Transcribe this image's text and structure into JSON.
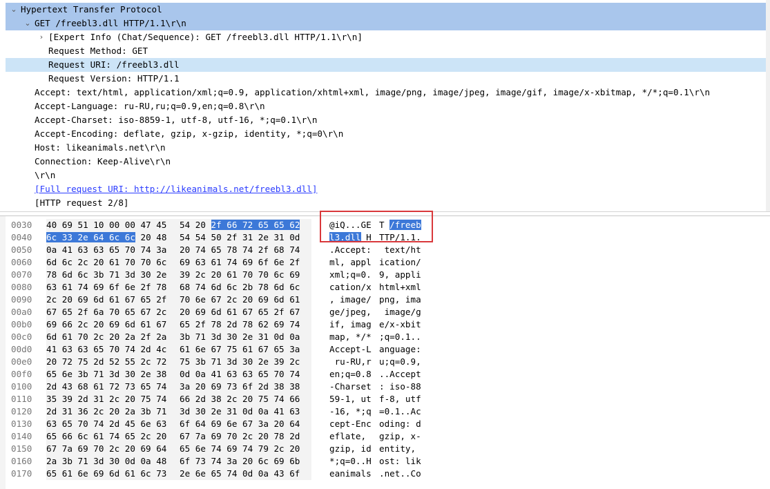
{
  "detail": {
    "rows": [
      {
        "text": "Hypertext Transfer Protocol",
        "arrow": "⌄",
        "level": 0,
        "highlight": "strong"
      },
      {
        "text": "GET /freebl3.dll HTTP/1.1\\r\\n",
        "arrow": "⌄",
        "level": 1,
        "highlight": "strong"
      },
      {
        "text": "[Expert Info (Chat/Sequence): GET /freebl3.dll HTTP/1.1\\r\\n]",
        "arrow": "›",
        "level": 2,
        "highlight": "none"
      },
      {
        "text": "Request Method: GET",
        "arrow": "",
        "level": 2,
        "highlight": "none"
      },
      {
        "text": "Request URI: /freebl3.dll",
        "arrow": "",
        "level": 2,
        "highlight": "light"
      },
      {
        "text": "Request Version: HTTP/1.1",
        "arrow": "",
        "level": 2,
        "highlight": "none"
      },
      {
        "text": "Accept: text/html, application/xml;q=0.9, application/xhtml+xml, image/png, image/jpeg, image/gif, image/x-xbitmap, */*;q=0.1\\r\\n",
        "arrow": "",
        "level": 1,
        "highlight": "none"
      },
      {
        "text": "Accept-Language: ru-RU,ru;q=0.9,en;q=0.8\\r\\n",
        "arrow": "",
        "level": 1,
        "highlight": "none"
      },
      {
        "text": "Accept-Charset: iso-8859-1, utf-8, utf-16, *;q=0.1\\r\\n",
        "arrow": "",
        "level": 1,
        "highlight": "none"
      },
      {
        "text": "Accept-Encoding: deflate, gzip, x-gzip, identity, *;q=0\\r\\n",
        "arrow": "",
        "level": 1,
        "highlight": "none"
      },
      {
        "text": "Host: likeanimals.net\\r\\n",
        "arrow": "",
        "level": 1,
        "highlight": "none"
      },
      {
        "text": "Connection: Keep-Alive\\r\\n",
        "arrow": "",
        "level": 1,
        "highlight": "none"
      },
      {
        "text": "\\r\\n",
        "arrow": "",
        "level": 1,
        "highlight": "none"
      },
      {
        "text": "[Full request URI: http://likeanimals.net/freebl3.dll]",
        "arrow": "",
        "level": 1,
        "highlight": "none",
        "link": true
      },
      {
        "text": "[HTTP request 2/8]",
        "arrow": "",
        "level": 1,
        "highlight": "none"
      }
    ]
  },
  "bytes": {
    "rows": [
      {
        "offset": "0030",
        "hex_lo": "40 69 51 10 00 00 47 45",
        "hex_hi": "54 20 2f 66 72 65 65 62",
        "ascii_lo": "@iQ...GE",
        "ascii_hi": "T /freeb"
      },
      {
        "offset": "0040",
        "hex_lo": "6c 33 2e 64 6c 6c 20 48",
        "hex_hi": "54 54 50 2f 31 2e 31 0d",
        "ascii_lo": "l3.dll H",
        "ascii_hi": "TTP/1.1."
      },
      {
        "offset": "0050",
        "hex_lo": "0a 41 63 63 65 70 74 3a",
        "hex_hi": "20 74 65 78 74 2f 68 74",
        "ascii_lo": ".Accept:",
        "ascii_hi": " text/ht"
      },
      {
        "offset": "0060",
        "hex_lo": "6d 6c 2c 20 61 70 70 6c",
        "hex_hi": "69 63 61 74 69 6f 6e 2f",
        "ascii_lo": "ml, appl",
        "ascii_hi": "ication/"
      },
      {
        "offset": "0070",
        "hex_lo": "78 6d 6c 3b 71 3d 30 2e",
        "hex_hi": "39 2c 20 61 70 70 6c 69",
        "ascii_lo": "xml;q=0.",
        "ascii_hi": "9, appli"
      },
      {
        "offset": "0080",
        "hex_lo": "63 61 74 69 6f 6e 2f 78",
        "hex_hi": "68 74 6d 6c 2b 78 6d 6c",
        "ascii_lo": "cation/x",
        "ascii_hi": "html+xml"
      },
      {
        "offset": "0090",
        "hex_lo": "2c 20 69 6d 61 67 65 2f",
        "hex_hi": "70 6e 67 2c 20 69 6d 61",
        "ascii_lo": ", image/",
        "ascii_hi": "png, ima"
      },
      {
        "offset": "00a0",
        "hex_lo": "67 65 2f 6a 70 65 67 2c",
        "hex_hi": "20 69 6d 61 67 65 2f 67",
        "ascii_lo": "ge/jpeg,",
        "ascii_hi": " image/g"
      },
      {
        "offset": "00b0",
        "hex_lo": "69 66 2c 20 69 6d 61 67",
        "hex_hi": "65 2f 78 2d 78 62 69 74",
        "ascii_lo": "if, imag",
        "ascii_hi": "e/x-xbit"
      },
      {
        "offset": "00c0",
        "hex_lo": "6d 61 70 2c 20 2a 2f 2a",
        "hex_hi": "3b 71 3d 30 2e 31 0d 0a",
        "ascii_lo": "map, */*",
        "ascii_hi": ";q=0.1.."
      },
      {
        "offset": "00d0",
        "hex_lo": "41 63 63 65 70 74 2d 4c",
        "hex_hi": "61 6e 67 75 61 67 65 3a",
        "ascii_lo": "Accept-L",
        "ascii_hi": "anguage:"
      },
      {
        "offset": "00e0",
        "hex_lo": "20 72 75 2d 52 55 2c 72",
        "hex_hi": "75 3b 71 3d 30 2e 39 2c",
        "ascii_lo": " ru-RU,r",
        "ascii_hi": "u;q=0.9,"
      },
      {
        "offset": "00f0",
        "hex_lo": "65 6e 3b 71 3d 30 2e 38",
        "hex_hi": "0d 0a 41 63 63 65 70 74",
        "ascii_lo": "en;q=0.8",
        "ascii_hi": "..Accept"
      },
      {
        "offset": "0100",
        "hex_lo": "2d 43 68 61 72 73 65 74",
        "hex_hi": "3a 20 69 73 6f 2d 38 38",
        "ascii_lo": "-Charset",
        "ascii_hi": ": iso-88"
      },
      {
        "offset": "0110",
        "hex_lo": "35 39 2d 31 2c 20 75 74",
        "hex_hi": "66 2d 38 2c 20 75 74 66",
        "ascii_lo": "59-1, ut",
        "ascii_hi": "f-8, utf"
      },
      {
        "offset": "0120",
        "hex_lo": "2d 31 36 2c 20 2a 3b 71",
        "hex_hi": "3d 30 2e 31 0d 0a 41 63",
        "ascii_lo": "-16, *;q",
        "ascii_hi": "=0.1..Ac"
      },
      {
        "offset": "0130",
        "hex_lo": "63 65 70 74 2d 45 6e 63",
        "hex_hi": "6f 64 69 6e 67 3a 20 64",
        "ascii_lo": "cept-Enc",
        "ascii_hi": "oding: d"
      },
      {
        "offset": "0140",
        "hex_lo": "65 66 6c 61 74 65 2c 20",
        "hex_hi": "67 7a 69 70 2c 20 78 2d",
        "ascii_lo": "eflate, ",
        "ascii_hi": "gzip, x-"
      },
      {
        "offset": "0150",
        "hex_lo": "67 7a 69 70 2c 20 69 64",
        "hex_hi": "65 6e 74 69 74 79 2c 20",
        "ascii_lo": "gzip, id",
        "ascii_hi": "entity, "
      },
      {
        "offset": "0160",
        "hex_lo": "2a 3b 71 3d 30 0d 0a 48",
        "hex_hi": "6f 73 74 3a 20 6c 69 6b",
        "ascii_lo": "*;q=0..H",
        "ascii_hi": "ost: lik"
      },
      {
        "offset": "0170",
        "hex_lo": "65 61 6e 69 6d 61 6c 73",
        "hex_hi": "2e 6e 65 74 0d 0a 43 6f",
        "ascii_lo": "eanimals",
        "ascii_hi": ".net..Co"
      }
    ],
    "selection": {
      "row0_hi_hex_start_byte": 2,
      "row1_lo_hex_end_byte": 6,
      "row0_ascii_hi_start_char": 2,
      "row1_ascii_lo_end_char": 6
    }
  },
  "colors": {
    "selected_tree_row": "#a9c6ec",
    "light_tree_row": "#cce4f7",
    "byte_selection": "#3c78d8",
    "annotation_box": "#d9383b"
  }
}
